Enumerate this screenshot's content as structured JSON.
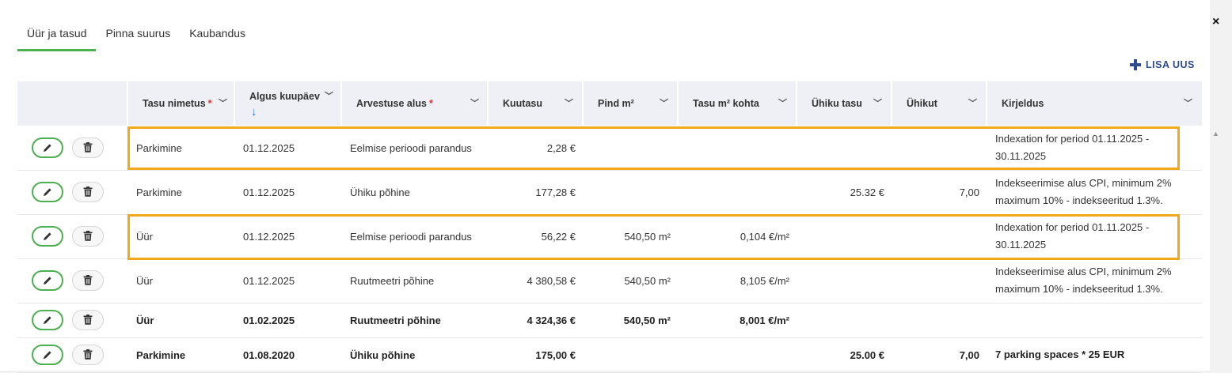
{
  "tabs": [
    "Üür ja tasud",
    "Pinna suurus",
    "Kaubandus"
  ],
  "close_label": "×",
  "add_button": "LISA UUS",
  "columns": {
    "tasu_nimetus": "Tasu nimetus",
    "algus_kuupaev": "Algus kuupäev",
    "arvestuse_alus": "Arvestuse alus",
    "kuutasu": "Kuutasu",
    "pind": "Pind m²",
    "tasu_m2": "Tasu m² kohta",
    "uhiku_tasu": "Ühiku tasu",
    "uhikut": "Ühikut",
    "kirjeldus": "Kirjeldus"
  },
  "required_mark": "*",
  "sort_indicator": "↓",
  "rows": [
    {
      "name": "Parkimine",
      "start": "01.12.2025",
      "basis": "Eelmise perioodi parandus",
      "monthly": "2,28 €",
      "area": "",
      "per_m2": "",
      "unit_price": "",
      "units": "",
      "desc": "Indexation for period 01.11.2025 - 30.11.2025"
    },
    {
      "name": "Parkimine",
      "start": "01.12.2025",
      "basis": "Ühiku põhine",
      "monthly": "177,28 €",
      "area": "",
      "per_m2": "",
      "unit_price": "25.32 €",
      "units": "7,00",
      "desc": "Indekseerimise alus CPI, minimum 2% maximum 10% - indekseeritud 1.3%."
    },
    {
      "name": "Üür",
      "start": "01.12.2025",
      "basis": "Eelmise perioodi parandus",
      "monthly": "56,22 €",
      "area": "540,50 m²",
      "per_m2": "0,104 €/m²",
      "unit_price": "",
      "units": "",
      "desc": "Indexation for period 01.11.2025 - 30.11.2025"
    },
    {
      "name": "Üür",
      "start": "01.12.2025",
      "basis": "Ruutmeetri põhine",
      "monthly": "4 380,58 €",
      "area": "540,50 m²",
      "per_m2": "8,105 €/m²",
      "unit_price": "",
      "units": "",
      "desc": "Indekseerimise alus CPI, minimum 2% maximum 10% - indekseeritud 1.3%."
    },
    {
      "name": "Üür",
      "start": "01.02.2025",
      "basis": "Ruutmeetri põhine",
      "monthly": "4 324,36 €",
      "area": "540,50 m²",
      "per_m2": "8,001 €/m²",
      "unit_price": "",
      "units": "",
      "desc": ""
    },
    {
      "name": "Parkimine",
      "start": "01.08.2020",
      "basis": "Ühiku põhine",
      "monthly": "175,00 €",
      "area": "",
      "per_m2": "",
      "unit_price": "25.00 €",
      "units": "7,00",
      "desc": "7 parking spaces * 25 EUR"
    }
  ],
  "colors": {
    "accent": "#4caf50",
    "link": "#2e4b8f",
    "highlight": "#f0a91a",
    "required": "#e03030"
  }
}
